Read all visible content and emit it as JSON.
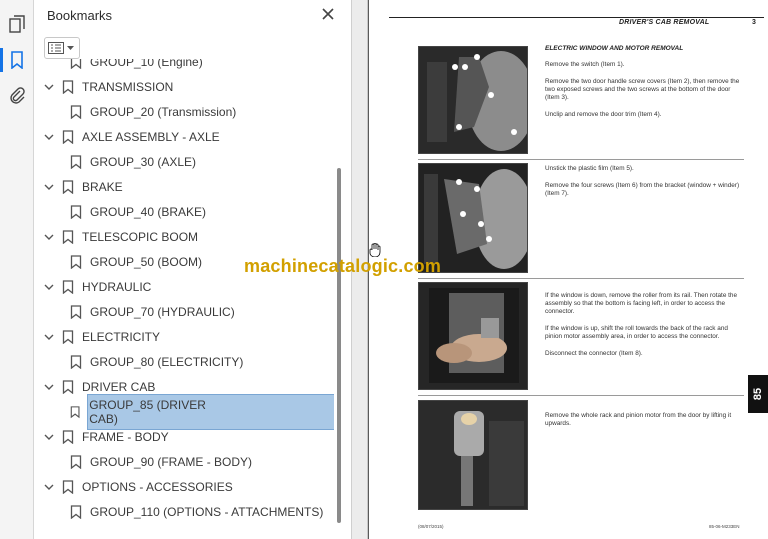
{
  "panel": {
    "title": "Bookmarks",
    "items": [
      {
        "label": "GROUP_10 (Engine)",
        "level": 1,
        "expandable": false
      },
      {
        "label": "TRANSMISSION",
        "level": 0,
        "expandable": true
      },
      {
        "label": "GROUP_20 (Transmission)",
        "level": 1,
        "expandable": false
      },
      {
        "label": "AXLE ASSEMBLY - AXLE",
        "level": 0,
        "expandable": true
      },
      {
        "label": "GROUP_30 (AXLE)",
        "level": 1,
        "expandable": false
      },
      {
        "label": "BRAKE",
        "level": 0,
        "expandable": true
      },
      {
        "label": "GROUP_40 (BRAKE)",
        "level": 1,
        "expandable": false
      },
      {
        "label": "TELESCOPIC BOOM",
        "level": 0,
        "expandable": true
      },
      {
        "label": "GROUP_50 (BOOM)",
        "level": 1,
        "expandable": false
      },
      {
        "label": "HYDRAULIC",
        "level": 0,
        "expandable": true
      },
      {
        "label": "GROUP_70 (HYDRAULIC)",
        "level": 1,
        "expandable": false
      },
      {
        "label": "ELECTRICITY",
        "level": 0,
        "expandable": true
      },
      {
        "label": "GROUP_80 (ELECTRICITY)",
        "level": 1,
        "expandable": false
      },
      {
        "label": "DRIVER CAB",
        "level": 0,
        "expandable": true
      },
      {
        "label": "GROUP_85 (DRIVER CAB)",
        "level": 1,
        "expandable": false,
        "selected": true
      },
      {
        "label": "FRAME - BODY",
        "level": 0,
        "expandable": true
      },
      {
        "label": "GROUP_90 (FRAME - BODY)",
        "level": 1,
        "expandable": false
      },
      {
        "label": "OPTIONS - ACCESSORIES",
        "level": 0,
        "expandable": true
      },
      {
        "label": "GROUP_110 (OPTIONS - ATTACHMENTS)",
        "level": 1,
        "expandable": false
      }
    ]
  },
  "page": {
    "header_title": "DRIVER'S CAB REMOVAL",
    "page_number": "3",
    "section_title": "ELECTRIC WINDOW AND MOTOR REMOVAL",
    "blocks": [
      [
        "Remove the switch (Item 1).",
        "Remove the two door handle screw covers (Item 2), then remove the two exposed screws and the two screws at the bottom of the door (Item 3).",
        "Unclip and remove the door trim (Item 4)."
      ],
      [
        "Unstick the plastic film (Item 5).",
        "Remove the four screws (Item 6) from the bracket (window + winder) (Item 7)."
      ],
      [
        "If the window is down, remove the roller from its rail. Then rotate the assembly so that the bottom is facing left, in order to access the connector.",
        "If the window is up, shift the roll towards the back of the rack and pinion motor assembly area, in order to access the connector.",
        "Disconnect the connector (Item 8)."
      ],
      [
        "Remove the whole rack and pinion motor from the door by lifting it upwards."
      ]
    ],
    "tab_label": "85",
    "footer_left": "(08/07/2015)",
    "footer_right": "85-06-M233EN"
  },
  "watermark": "machinecatalogic.com",
  "colors": {
    "selection": "#a9c8e6",
    "accent": "#1473e6",
    "watermark": "#d2a000"
  }
}
